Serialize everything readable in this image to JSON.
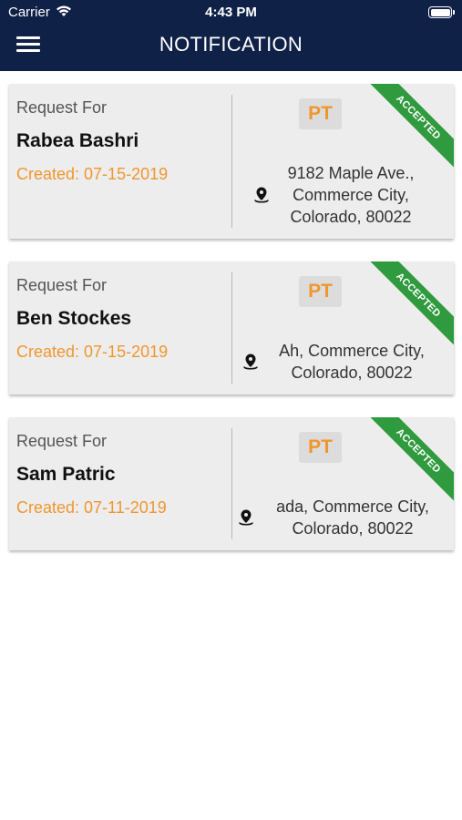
{
  "status_bar": {
    "carrier": "Carrier",
    "time": "4:43 PM"
  },
  "header": {
    "title": "NOTIFICATION"
  },
  "notifications": [
    {
      "label": "Request For",
      "name": "Rabea Bashri",
      "created": "Created: 07-15-2019",
      "tag": "PT",
      "ribbon": "ACCEPTED",
      "address_lines": [
        "9182 Maple Ave.,",
        "Commerce City,",
        "Colorado, 80022"
      ]
    },
    {
      "label": "Request For",
      "name": "Ben Stockes",
      "created": "Created: 07-15-2019",
      "tag": "PT",
      "ribbon": "ACCEPTED",
      "address_lines": [
        "Ah, Commerce City,",
        "Colorado, 80022"
      ]
    },
    {
      "label": "Request For",
      "name": "Sam Patric",
      "created": "Created: 07-11-2019",
      "tag": "PT",
      "ribbon": "ACCEPTED",
      "address_lines": [
        "ada, Commerce City,",
        "Colorado, 80022"
      ]
    }
  ],
  "colors": {
    "header_bg": "#0f2146",
    "accent_orange": "#f0962e",
    "ribbon_green": "#2f9a3e"
  },
  "icons": {
    "menu": "hamburger-icon",
    "location": "location-pin-icon",
    "wifi": "wifi-icon",
    "battery": "battery-icon"
  }
}
